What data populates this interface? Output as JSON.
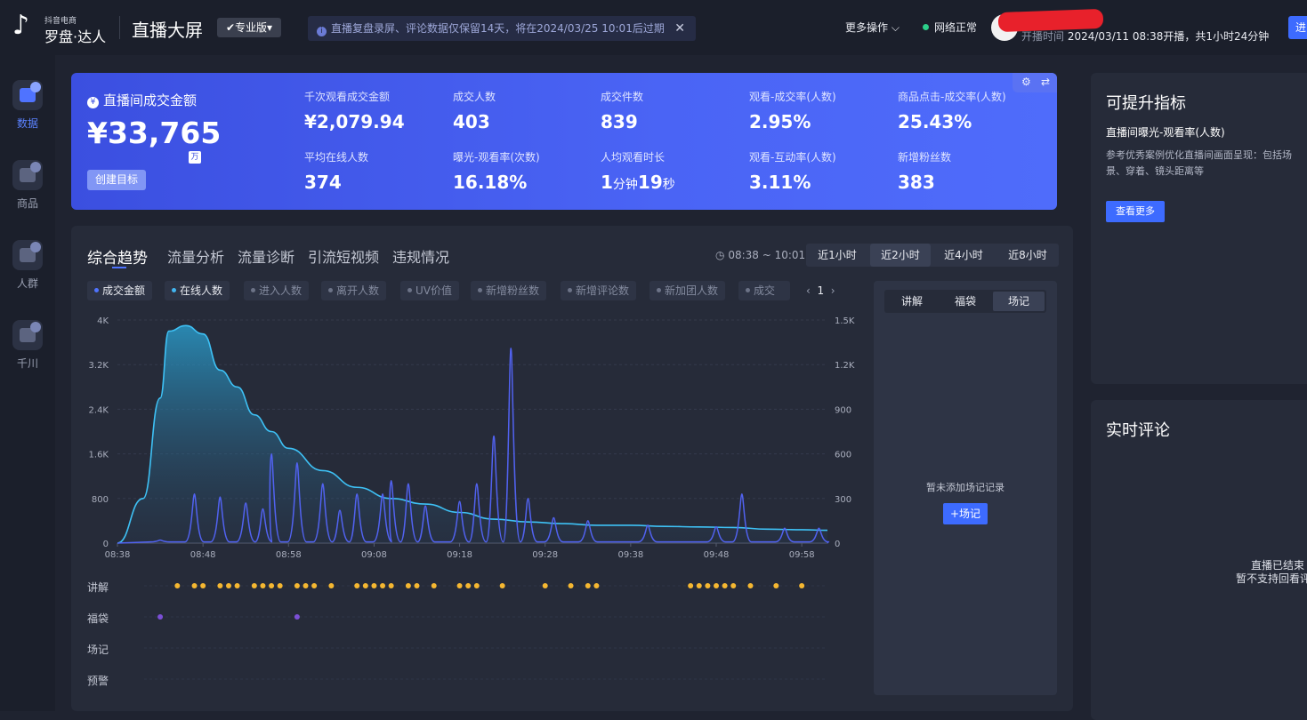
{
  "header": {
    "logo_small": "抖音电商",
    "logo_main": "罗盘·达人",
    "title": "直播大屏",
    "edition": "✔专业版▾",
    "notice": "直播复盘录屏、评论数据仅保留14天，将在2024/03/25 10:01后过期",
    "more_ops": "更多操作 ⌵",
    "network": "网络正常",
    "start_label": "开播时间",
    "start_value": "2024/03/11 08:38开播，共1小时24分钟",
    "enter_btn": "进"
  },
  "nav": [
    {
      "label": "数据",
      "icon": "data-chart-icon",
      "active": true
    },
    {
      "label": "商品",
      "icon": "cart-icon",
      "active": false
    },
    {
      "label": "人群",
      "icon": "people-icon",
      "active": false
    },
    {
      "label": "千川",
      "icon": "qianchuan-icon",
      "active": false
    }
  ],
  "kpi_main": {
    "label": "直播间成交金额",
    "value": "¥33,765",
    "unit": "万",
    "goal_btn": "创建目标"
  },
  "kpis": [
    {
      "label": "千次观看成交金额",
      "value": "¥2,079.94"
    },
    {
      "label": "成交人数",
      "value": "403"
    },
    {
      "label": "成交件数",
      "value": "839"
    },
    {
      "label": "观看-成交率(人数)",
      "value": "2.95%"
    },
    {
      "label": "商品点击-成交率(人数)",
      "value": "25.43%"
    },
    {
      "label": "平均在线人数",
      "value": "374"
    },
    {
      "label": "曝光-观看率(次数)",
      "value": "16.18%"
    },
    {
      "label": "人均观看时长",
      "v1": "1",
      "u1": "分钟",
      "v2": "19",
      "u2": "秒"
    },
    {
      "label": "观看-互动率(人数)",
      "value": "3.11%"
    },
    {
      "label": "新增粉丝数",
      "value": "383"
    }
  ],
  "improve": {
    "title": "可提升指标",
    "metric": "直播间曝光-观看率(人数)",
    "desc": "参考优秀案例优化直播间画面呈现：包括场景、穿着、镜头距离等",
    "btn": "查看更多"
  },
  "comments": {
    "title": "实时评论",
    "msg1": "直播已结束",
    "msg2": "暂不支持回看评"
  },
  "trend": {
    "tabs": [
      "综合趋势",
      "流量分析",
      "流量诊断",
      "引流短视频",
      "违规情况"
    ],
    "time_range": "08:38 ~ 10:01",
    "ranges": [
      "近1小时",
      "近2小时",
      "近4小时",
      "近8小时"
    ],
    "active_range": 1,
    "metrics": [
      "成交金额",
      "在线人数",
      "进入人数",
      "离开人数",
      "UV价值",
      "新增粉丝数",
      "新增评论数",
      "新加团人数",
      "成交"
    ],
    "page": "1",
    "side_tabs": [
      "讲解",
      "福袋",
      "场记"
    ],
    "side_empty": "暂未添加场记记录",
    "side_add": "+场记",
    "rows": [
      "讲解",
      "福袋",
      "场记",
      "预警"
    ]
  },
  "chart_data": {
    "type": "area",
    "x_ticks": [
      "08:38",
      "08:48",
      "08:58",
      "09:08",
      "09:18",
      "09:28",
      "09:38",
      "09:48",
      "09:58"
    ],
    "y_left_ticks": [
      "0",
      "800",
      "1.6K",
      "2.4K",
      "3.2K",
      "4K"
    ],
    "y_right_ticks": [
      "0",
      "300",
      "600",
      "900",
      "1.2K",
      "1.5K"
    ],
    "y_left_range": [
      0,
      4000
    ],
    "y_right_range": [
      0,
      1500
    ],
    "x_minutes": [
      0,
      3,
      5,
      6,
      8,
      10,
      12,
      14,
      16,
      18,
      20,
      24,
      28,
      32,
      36,
      40,
      44,
      48,
      52,
      56,
      60,
      64,
      68,
      72,
      76,
      80,
      83
    ],
    "series": [
      {
        "name": "在线人数",
        "color": "#3ec1f5",
        "axis": "left",
        "values": [
          0,
          800,
          2600,
          3800,
          3900,
          3750,
          3100,
          2800,
          2300,
          2000,
          1700,
          1300,
          1000,
          800,
          700,
          550,
          430,
          380,
          350,
          320,
          320,
          300,
          290,
          280,
          250,
          240,
          230
        ]
      },
      {
        "name": "成交金额",
        "color": "#5162f0",
        "axis": "right",
        "spikes": [
          [
            5,
            20
          ],
          [
            9,
            330
          ],
          [
            12,
            310
          ],
          [
            15,
            270
          ],
          [
            17,
            230
          ],
          [
            18,
            600
          ],
          [
            21,
            540
          ],
          [
            24,
            400
          ],
          [
            26,
            220
          ],
          [
            28,
            330
          ],
          [
            31,
            330
          ],
          [
            32,
            420
          ],
          [
            34,
            400
          ],
          [
            36,
            250
          ],
          [
            40,
            280
          ],
          [
            42,
            400
          ],
          [
            44,
            720
          ],
          [
            46,
            1310
          ],
          [
            48,
            300
          ],
          [
            51,
            170
          ],
          [
            55,
            150
          ],
          [
            62,
            120
          ],
          [
            70,
            110
          ],
          [
            73,
            330
          ],
          [
            78,
            100
          ],
          [
            82,
            100
          ]
        ]
      }
    ],
    "event_dots": {
      "讲解": [
        7,
        9,
        10,
        12,
        13,
        14,
        16,
        17,
        18,
        19,
        21,
        22,
        23,
        25,
        28,
        29,
        30,
        31,
        32,
        34,
        35,
        37,
        40,
        41,
        42,
        45,
        50,
        53,
        55,
        56,
        67,
        68,
        69,
        70,
        71,
        72,
        74,
        77,
        80
      ],
      "福袋": [
        5,
        21
      ]
    }
  }
}
